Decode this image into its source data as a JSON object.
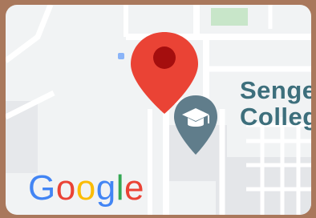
{
  "map": {
    "background_color": "#f1f3f4",
    "road_color": "#ffffff",
    "building_color": "#e3e5e8",
    "park_color": "#c8e6c9"
  },
  "pin": {
    "icon": "map-pin-icon",
    "color": "#ea4335",
    "dot_color": "#a50e0e"
  },
  "place": {
    "icon": "graduation-cap-icon",
    "pin_color": "#607d8b",
    "name": "Senge\nColleg"
  },
  "logo": {
    "icon": "google-logo",
    "letters": [
      {
        "char": "G",
        "color": "#4285f4"
      },
      {
        "char": "o",
        "color": "#ea4335"
      },
      {
        "char": "o",
        "color": "#fbbc05"
      },
      {
        "char": "g",
        "color": "#4285f4"
      },
      {
        "char": "l",
        "color": "#34a853"
      },
      {
        "char": "e",
        "color": "#ea4335"
      }
    ]
  }
}
